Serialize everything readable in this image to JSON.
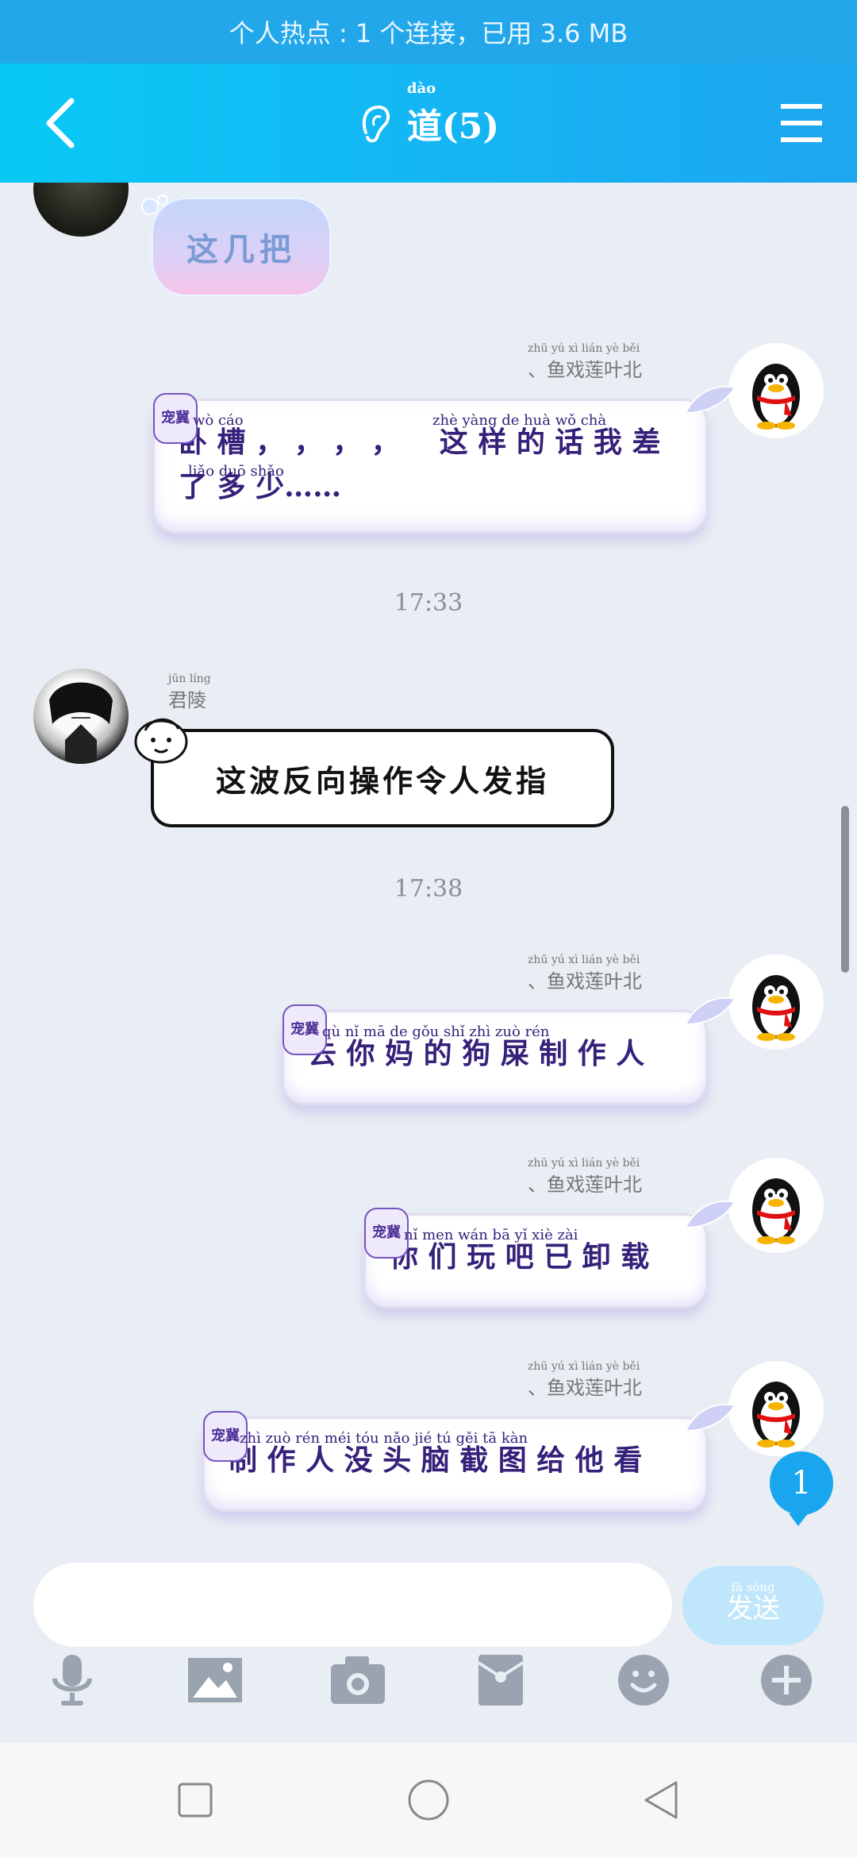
{
  "status_bar": {
    "text": "个人热点 : 1 个连接，已用 3.6 MB"
  },
  "header": {
    "title": "道(5)",
    "title_pinyin": "dào"
  },
  "messages": [
    {
      "text": "这几把"
    },
    {
      "nickname": "、鱼戏莲叶北",
      "nickname_pinyin": "zhū yú xì lián yè běi",
      "tag": "宠冀",
      "line1": "卧 槽 ， ， ， ，    这 样 的 话 我 差",
      "line2": "了 多 少……",
      "pinyin1a": "wò  cáo",
      "pinyin1b": "zhè yàng  de  huà  wǒ  chà",
      "pinyin2": "liǎo duō shǎo"
    },
    {
      "time": "17:33"
    },
    {
      "nickname": "君陵",
      "nickname_pinyin": "jūn líng",
      "text": "这波反向操作令人发指"
    },
    {
      "time": "17:38"
    },
    {
      "nickname": "、鱼戏莲叶北",
      "nickname_pinyin": "zhū yú xì lián yè běi",
      "tag": "宠冀",
      "text": "去 你 妈 的 狗 屎 制 作 人",
      "pinyin": "qù  nǐ  mā  de  gǒu shǐ zhì zuò rén"
    },
    {
      "nickname": "、鱼戏莲叶北",
      "nickname_pinyin": "zhū yú xì lián yè běi",
      "tag": "宠冀",
      "text": "你 们 玩 吧 已 卸 载",
      "pinyin": "nǐ  men wán  bā   yǐ  xiè  zài"
    },
    {
      "nickname": "、鱼戏莲叶北",
      "nickname_pinyin": "zhū yú xì lián yè běi",
      "tag": "宠冀",
      "text": "制 作 人 没 头 脑 截 图 给 他 看",
      "pinyin": "zhì zuò rén méi tóu nǎo jié  tú  gěi  tā  kàn"
    }
  ],
  "unread_count": "1",
  "input": {
    "value": "",
    "send_label": "发送",
    "send_pinyin": "fā sòng"
  },
  "toolbar": [
    "microphone",
    "image",
    "camera",
    "red-packet",
    "emoji",
    "plus"
  ],
  "colors": {
    "header_start": "#08c9f6",
    "header_end": "#1ea6ef",
    "bubble_text": "#35207a",
    "background": "#e9edf4"
  }
}
